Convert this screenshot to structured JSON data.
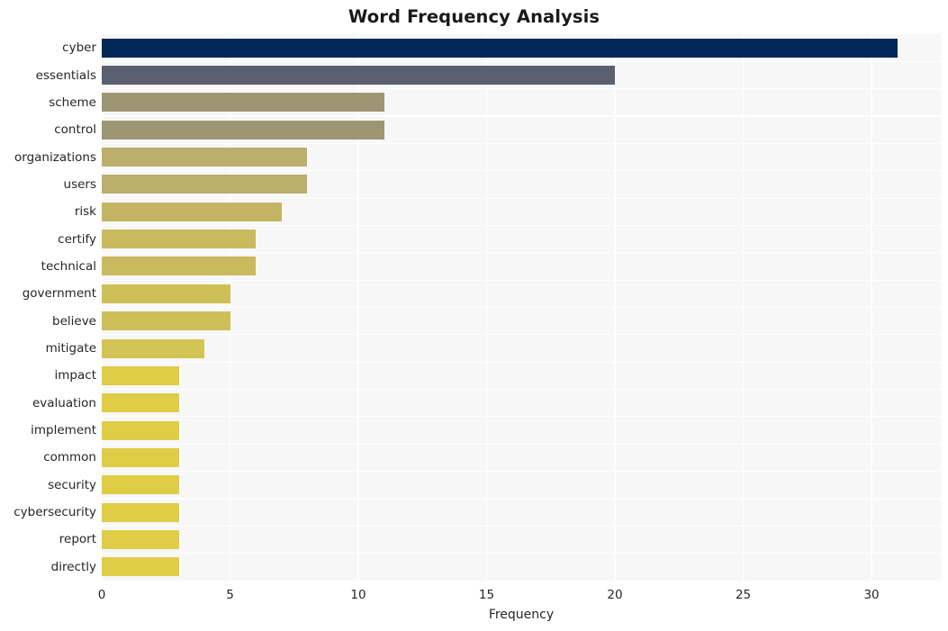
{
  "chart_data": {
    "type": "bar",
    "orientation": "horizontal",
    "title": "Word Frequency Analysis",
    "xlabel": "Frequency",
    "ylabel": "",
    "xlim": [
      0,
      32.7
    ],
    "xticks": [
      0,
      5,
      10,
      15,
      20,
      25,
      30
    ],
    "xtick_labels": [
      "0",
      "5",
      "10",
      "15",
      "20",
      "25",
      "30"
    ],
    "grid": true,
    "grid_color": "#ffffff",
    "plot_background": "#f7f7f7",
    "figure_background": "#ffffff",
    "legend": null,
    "categories": [
      "cyber",
      "essentials",
      "scheme",
      "control",
      "organizations",
      "users",
      "risk",
      "certify",
      "technical",
      "government",
      "believe",
      "mitigate",
      "impact",
      "evaluation",
      "implement",
      "common",
      "security",
      "cybersecurity",
      "report",
      "directly"
    ],
    "values": [
      31,
      20,
      11,
      11,
      8,
      8,
      7,
      6,
      6,
      5,
      5,
      4,
      3,
      3,
      3,
      3,
      3,
      3,
      3,
      3
    ],
    "colors": [
      "#002758",
      "#5b6070",
      "#9c9673",
      "#9c9673",
      "#bcae6b",
      "#bcae6b",
      "#c3b463",
      "#c9ba5e",
      "#c9ba5e",
      "#cebf59",
      "#cebf59",
      "#d3c453",
      "#dfcd45",
      "#dfcd45",
      "#dfcd45",
      "#dfcd45",
      "#dfcd45",
      "#dfcd45",
      "#dfcd45",
      "#dfcd45"
    ]
  }
}
